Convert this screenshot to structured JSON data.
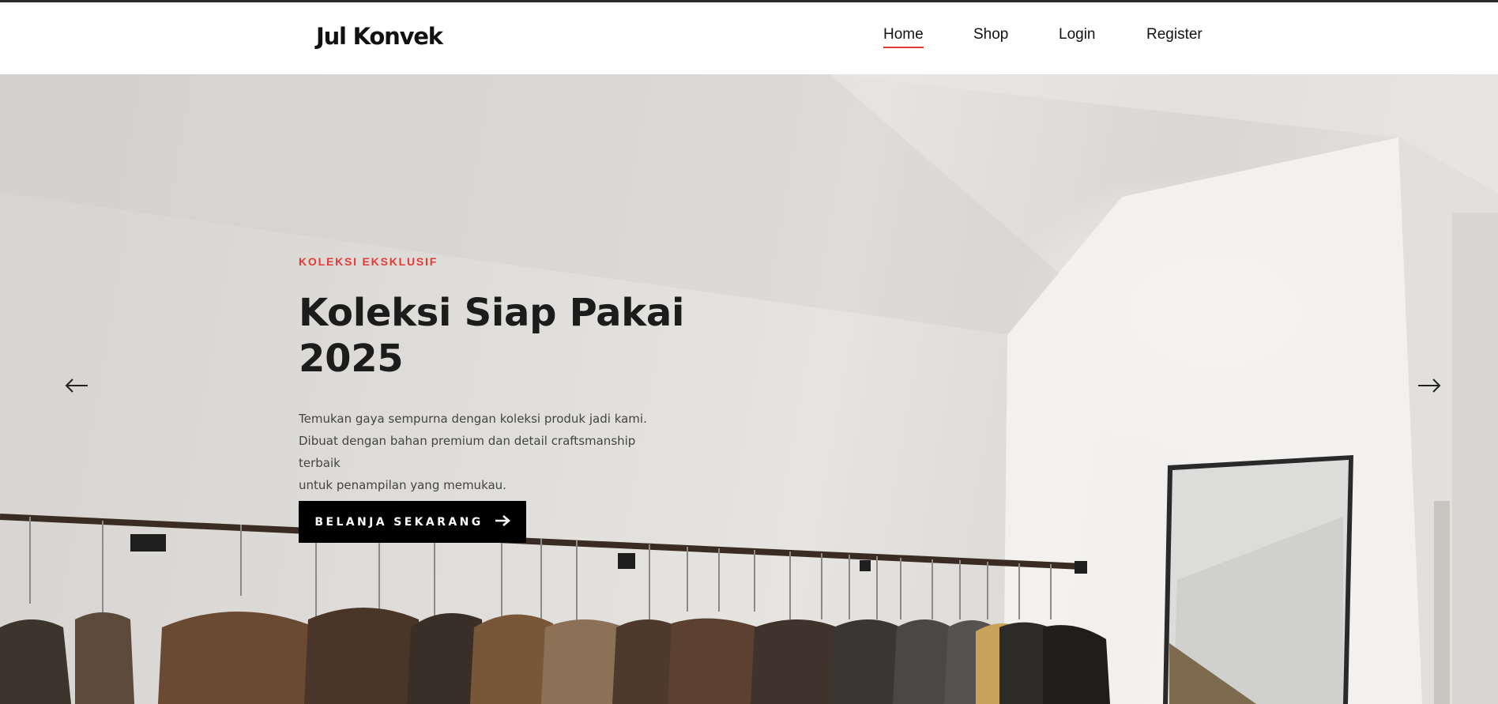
{
  "brand": {
    "name": "Jul Konvek"
  },
  "nav": {
    "items": [
      {
        "label": "Home",
        "active": true
      },
      {
        "label": "Shop",
        "active": false
      },
      {
        "label": "Login",
        "active": false
      },
      {
        "label": "Register",
        "active": false
      }
    ]
  },
  "hero": {
    "eyebrow": "KOLEKSI EKSKLUSIF",
    "title_line1": "Koleksi Siap Pakai",
    "title_line2": "2025",
    "description_line1": "Temukan gaya sempurna dengan koleksi produk jadi kami.",
    "description_line2": "Dibuat dengan bahan premium dan detail craftsmanship terbaik",
    "description_line3": "untuk penampilan yang memukau.",
    "cta_label": "BELANJA SEKARANG",
    "cta_icon": "arrow-right-icon",
    "prev_icon": "arrow-left-icon",
    "next_icon": "arrow-right-icon"
  },
  "colors": {
    "accent": "#e53935",
    "text": "#111111",
    "button_bg": "#000000"
  }
}
